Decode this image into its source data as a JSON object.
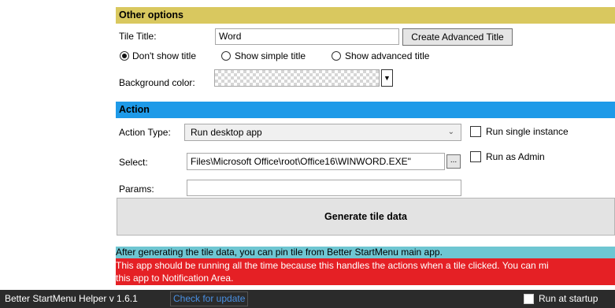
{
  "other_options": {
    "header": "Other options",
    "tile_title_label": "Tile Title:",
    "tile_title_value": "Word",
    "create_advanced_title": "Create Advanced Title",
    "radios": [
      {
        "label": "Don't show title",
        "checked": true
      },
      {
        "label": "Show simple title",
        "checked": false
      },
      {
        "label": "Show advanced title",
        "checked": false
      }
    ],
    "background_color_label": "Background color:"
  },
  "action": {
    "header": "Action",
    "action_type_label": "Action Type:",
    "action_type_value": "Run desktop app",
    "run_single_instance": "Run single instance",
    "select_label": "Select:",
    "select_value": "Files\\Microsoft Office\\root\\Office16\\WINWORD.EXE\"",
    "browse_label": "...",
    "run_as_admin": "Run as Admin",
    "params_label": "Params:",
    "params_value": "",
    "generate_button": "Generate tile data"
  },
  "messages": {
    "info": "After generating the tile data, you can pin tile from Better StartMenu main app.",
    "warning_line1": "This app should be running all the time because this handles the actions when a tile clicked. You can mi",
    "warning_line2": "this app to Notification Area."
  },
  "statusbar": {
    "app_version": "Better StartMenu Helper v 1.6.1",
    "check_update": "Check for update",
    "run_at_startup": "Run at startup"
  },
  "colors": {
    "other_options_header": "#d9c85f",
    "action_header": "#1e9ae8",
    "info_bar": "#6ec6d2",
    "warning_bar": "#e52025",
    "statusbar": "#2b2b2b"
  }
}
